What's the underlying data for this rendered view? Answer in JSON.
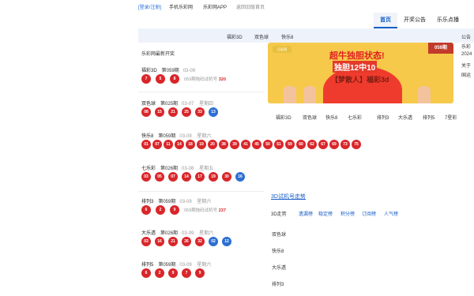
{
  "topbar": {
    "login": "[登录/注册]",
    "mobile": "手机乐彩网",
    "app": "乐彩网APP",
    "oldhome": "返回旧版首页"
  },
  "mainnav": [
    "首页",
    "开奖公告",
    "乐乐点播"
  ],
  "typebar": [
    "福彩3D",
    "双色球",
    "快乐8"
  ],
  "leftpanel": {
    "title": "乐彩网最新开奖",
    "lotteries": [
      {
        "name": "福彩3D",
        "issue": "第059期",
        "date": "03-09",
        "weekday": "",
        "balls": [
          "7",
          "5",
          "8"
        ],
        "blue": [],
        "note": "059期拖码试机号",
        "note_num": "320"
      },
      {
        "name": "双色球",
        "issue": "第025期",
        "date": "03-07",
        "weekday": "星期四",
        "balls": [
          "08",
          "15",
          "21",
          "25",
          "33"
        ],
        "blue": [
          "13"
        ],
        "note": "",
        "note_num": ""
      },
      {
        "name": "快乐8",
        "issue": "第059期",
        "date": "03-09",
        "weekday": "星期六",
        "balls": [
          "01",
          "07",
          "11",
          "14",
          "18",
          "19",
          "20",
          "38",
          "39",
          "41",
          "45",
          "50",
          "51",
          "59",
          "60",
          "62",
          "67",
          "69",
          "73",
          "75"
        ],
        "blue": [],
        "note": "",
        "note_num": ""
      },
      {
        "name": "七乐彩",
        "issue": "第026期",
        "date": "03-08",
        "weekday": "星期五",
        "balls": [
          "03",
          "05",
          "07",
          "14",
          "17",
          "19",
          "30"
        ],
        "blue": [
          "16"
        ],
        "note": "",
        "note_num": ""
      },
      {
        "name": "排列3",
        "issue": "第059期",
        "date": "03-09",
        "weekday": "星期六",
        "balls": [
          "6",
          "2",
          "9"
        ],
        "blue": [],
        "note": "059期拖码试机号",
        "note_num": "237"
      },
      {
        "name": "大乐透",
        "issue": "第026期",
        "date": "03-09",
        "weekday": "星期六",
        "balls": [
          "03",
          "16",
          "21",
          "26",
          "32"
        ],
        "blue": [
          "02",
          "12"
        ],
        "note": "",
        "note_num": ""
      },
      {
        "name": "排列5",
        "issue": "第059期",
        "date": "03-09",
        "weekday": "星期六",
        "balls": [
          "6",
          "2",
          "9",
          "7",
          "9"
        ],
        "blue": [],
        "note": "",
        "note_num": ""
      }
    ]
  },
  "banner": {
    "logo": "乐彩网",
    "headline": "超牛独胆状态!",
    "subline": "独胆12中10",
    "tagline": "【梦散人】福彩3d",
    "issue": "059期"
  },
  "gametabs": [
    "福彩3D",
    "双色球",
    "快乐8",
    "七乐彩",
    "排列3",
    "大乐透",
    "排列5",
    "7星彩"
  ],
  "rightnote": [
    "公告",
    "乐彩",
    "2024",
    "关于",
    "国运"
  ],
  "section": {
    "title": "3D试机号走势",
    "subtabs": [
      "3D走势",
      "遗漏榜",
      "稳定榜",
      "积分榜",
      "订阅榜",
      "人气榜"
    ],
    "categories": [
      "双色球",
      "快乐8",
      "大乐透",
      "排列3"
    ]
  },
  "colors": {
    "ball_red": "#d9262a",
    "ball_blue": "#2d6fd2",
    "link": "#1a5fc9"
  }
}
